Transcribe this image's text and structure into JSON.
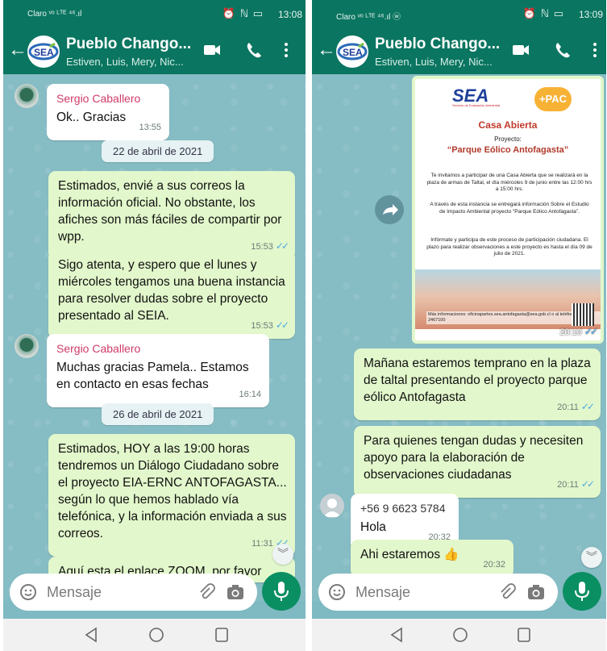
{
  "left": {
    "status": {
      "carrier": "Claro ᵛᵒ ᴸᵀᴱ ⁴⁶.ıl",
      "icons": "⏰ ℕ ▭",
      "time": "13:08"
    },
    "header": {
      "title": "Pueblo Chango...",
      "subtitle": "Estiven, Luis, Mery, Nic..."
    },
    "messages": [
      {
        "sender": "Sergio Caballero",
        "text": "Ok.. Gracias",
        "time": "13:55"
      },
      {
        "date": "22 de abril de 2021"
      },
      {
        "text": "Estimados, envié a sus correos la información oficial. No obstante, los afiches son más fáciles de compartir por wpp.",
        "time": "15:53"
      },
      {
        "text": "Sigo atenta, y espero que el lunes y miércoles tengamos una buena instancia para resolver dudas sobre el proyecto presentado al SEIA.",
        "time": "15:53"
      },
      {
        "sender": "Sergio Caballero",
        "text": "Muchas gracias Pamela.. Estamos en contacto en esas fechas",
        "time": "16:14"
      },
      {
        "date": "26 de abril de 2021"
      },
      {
        "text": "Estimados, HOY a las 19:00 horas tendremos un Diálogo Ciudadano sobre el proyecto EIA-ERNC ANTOFAGASTA... según lo que hemos hablado vía telefónica, y la información enviada a sus correos.",
        "time": "11:31"
      },
      {
        "text": "Aquí esta el enlace ZOOM, por favor"
      }
    ],
    "input_placeholder": "Mensaje"
  },
  "right": {
    "status": {
      "carrier": "Claro ᵛᵒ ᴸᵀᴱ ⁴⁶.ıl ⓦ",
      "icons": "⏰ ℕ ▭",
      "time": "13:09"
    },
    "header": {
      "title": "Pueblo Chango...",
      "subtitle": "Estiven, Luis, Mery, Nic..."
    },
    "poster": {
      "logo_left": "SEA",
      "logo_left_sub": "Servicio de Evaluación Ambiental",
      "logo_right": "+PAC",
      "title": "Casa Abierta",
      "proyecto": "Proyecto:",
      "name": "“Parque Eólico Antofagasta”",
      "t1": "Te invitamos a participar de una Casa Abierta que se realizará en la plaza de armas de Taltal, el día miércoles 9 de junio entre las 12:00 hrs a 15:00 hrs.",
      "t2": "A través de esta instancia se entregará información Sobre el Estudio de Impacto Ambiental proyecto “Parque Eólico Antofagasta”.",
      "t3": "Infórmate y participa de este proceso de participación ciudadana. El plazo para realizar observaciones a este proyecto es hasta el día 09 de julio de 2021.",
      "info": "Más informaciones: oficinapartes.sea.antofagasta@sea.gob.cl o al teléfono 55-2467100",
      "time": "20:10"
    },
    "messages": [
      {
        "text": "Mañana estaremos temprano en la plaza de taltal presentando el proyecto parque eólico Antofagasta",
        "time": "20:11"
      },
      {
        "text": "Para quienes tengan dudas y necesiten apoyo para la elaboración de observaciones ciudadanas",
        "time": "20:11"
      },
      {
        "sender": "+56 9 6623 5784",
        "text": "Hola",
        "time": "20:32"
      },
      {
        "text": "Ahi estaremos 👍",
        "time": "20:32"
      }
    ],
    "input_placeholder": "Mensaje"
  },
  "colors": {
    "header": "#0a7560",
    "outgoing": "#e2f7cb",
    "incoming": "#ffffff",
    "mic": "#0a8f63",
    "sender_name": "#d03b68",
    "read_tick": "#4fa8e6"
  }
}
